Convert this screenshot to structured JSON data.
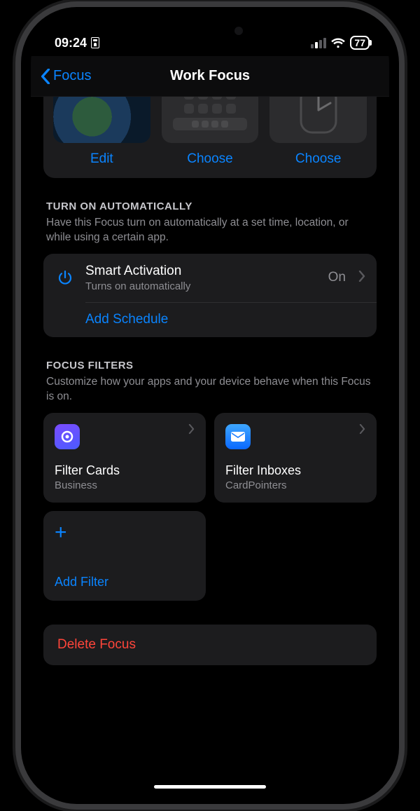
{
  "status": {
    "time": "09:24",
    "battery": "77"
  },
  "nav": {
    "back": "Focus",
    "title": "Work Focus"
  },
  "customize": {
    "items": [
      {
        "label": "Edit"
      },
      {
        "label": "Choose"
      },
      {
        "label": "Choose"
      }
    ]
  },
  "auto": {
    "header": "TURN ON AUTOMATICALLY",
    "desc": "Have this Focus turn on automatically at a set time, location, or while using a certain app.",
    "smart": {
      "title": "Smart Activation",
      "sub": "Turns on automatically",
      "value": "On"
    },
    "add": "Add Schedule"
  },
  "filters": {
    "header": "FOCUS FILTERS",
    "desc": "Customize how your apps and your device behave when this Focus is on.",
    "tiles": [
      {
        "title": "Filter Cards",
        "sub": "Business"
      },
      {
        "title": "Filter Inboxes",
        "sub": "CardPointers"
      }
    ],
    "add": "Add Filter"
  },
  "delete": "Delete Focus"
}
